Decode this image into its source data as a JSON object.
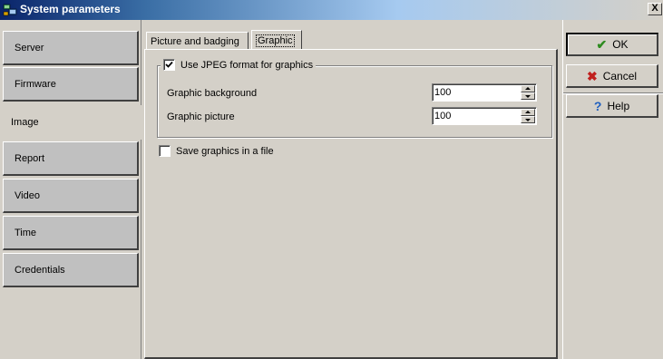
{
  "window": {
    "title": "System parameters",
    "close_label": "X"
  },
  "sidebar": {
    "items": [
      {
        "label": "Server",
        "active": false
      },
      {
        "label": "Firmware",
        "active": false
      },
      {
        "label": "Image",
        "active": true
      },
      {
        "label": "Report",
        "active": false
      },
      {
        "label": "Video",
        "active": false
      },
      {
        "label": "Time",
        "active": false
      },
      {
        "label": "Credentials",
        "active": false
      }
    ]
  },
  "tabs": [
    {
      "label": "Picture and badging",
      "active": false
    },
    {
      "label": "Graphic",
      "active": true
    }
  ],
  "graphic": {
    "use_jpeg": {
      "label": "Use JPEG format for graphics",
      "checked": true
    },
    "background": {
      "label": "Graphic background",
      "value": "100"
    },
    "picture": {
      "label": "Graphic picture",
      "value": "100"
    },
    "save_file": {
      "label": "Save graphics in a file",
      "checked": false
    }
  },
  "actions": {
    "ok_label": "OK",
    "cancel_label": "Cancel",
    "help_label": "Help"
  },
  "colors": {
    "ok_check": "#2e8b1f",
    "cancel_x": "#c0201e",
    "help_q": "#1f5fbf"
  }
}
